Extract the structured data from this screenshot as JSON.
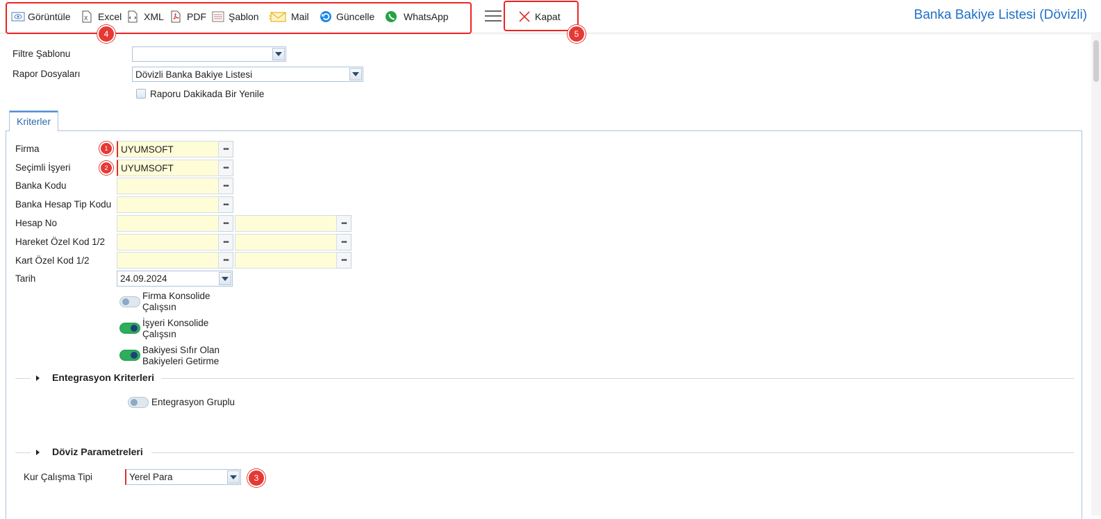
{
  "toolbar": {
    "view_label": "Görüntüle",
    "excel_label": "Excel",
    "xml_label": "XML",
    "pdf_label": "PDF",
    "template_label": "Şablon",
    "mail_label": "Mail",
    "refresh_label": "Güncelle",
    "whatsapp_label": "WhatsApp",
    "close_label": "Kapat"
  },
  "page_title": "Banka Bakiye Listesi (Dövizli)",
  "badges": {
    "b1": "1",
    "b2": "2",
    "b3": "3",
    "b4": "4",
    "b5": "5"
  },
  "filters": {
    "template_label": "Filtre Şablonu",
    "template_value": "",
    "report_files_label": "Rapor Dosyaları",
    "report_files_value": "Dövizli Banka Bakiye Listesi",
    "auto_refresh_label": "Raporu Dakikada Bir Yenile"
  },
  "tabs": {
    "criteria": "Kriterler"
  },
  "criteria": {
    "firma_label": "Firma",
    "firma_value": "UYUMSOFT",
    "isyeri_label": "Seçimli İşyeri",
    "isyeri_value": "UYUMSOFT",
    "banka_kodu_label": "Banka Kodu",
    "banka_hesap_tip_label": "Banka Hesap Tip Kodu",
    "hesap_no_label": "Hesap No",
    "hareket_ozel_kod_label": "Hareket Özel Kod 1/2",
    "kart_ozel_kod_label": "Kart Özel Kod 1/2",
    "tarih_label": "Tarih",
    "tarih_value": "24.09.2024",
    "firma_konsolide_label_1": "Firma Konsolide",
    "firma_konsolide_label_2": "Çalışsın",
    "isyeri_konsolide_label_1": "İşyeri Konsolide",
    "isyeri_konsolide_label_2": "Çalışsın",
    "sifir_bakiye_label_1": "Bakiyesi Sıfır Olan",
    "sifir_bakiye_label_2": "Bakiyeleri Getirme"
  },
  "integration": {
    "title": "Entegrasyon Kriterleri",
    "grouped_label": "Entegrasyon Gruplu"
  },
  "currency": {
    "title": "Döviz Parametreleri",
    "rate_type_label": "Kur Çalışma Tipi",
    "rate_type_value": "Yerel Para"
  },
  "colors": {
    "accent": "#1e6fc6",
    "required": "#d93030",
    "lookup_bg": "#fffdd8",
    "toggle_on": "#2cae5a"
  }
}
